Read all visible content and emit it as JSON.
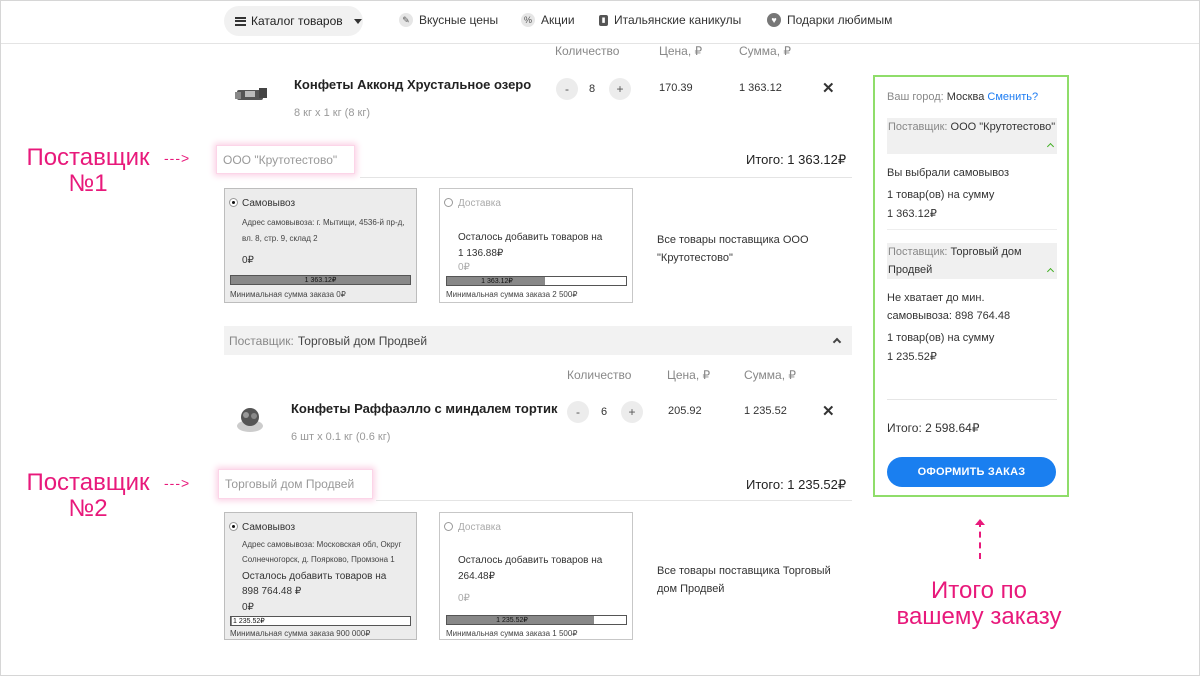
{
  "nav": {
    "catalog": "Каталог товаров",
    "links": [
      {
        "label": "Вкусные цены",
        "icon": "tag-icon"
      },
      {
        "label": "Акции",
        "icon": "percent-icon"
      },
      {
        "label": "Итальянские каникулы",
        "icon": "flag-icon"
      },
      {
        "label": "Подарки любимым",
        "icon": "heart-icon"
      }
    ]
  },
  "supplier1": {
    "headers": {
      "qty": "Количество",
      "price": "Цена, ₽",
      "sum": "Сумма, ₽"
    },
    "product": {
      "name": "Конфеты Акконд Хрустальное озеро",
      "sub": "8 кг x 1 кг (8 кг)",
      "qty": "8",
      "price": "170.39",
      "sum": "1 363.12"
    },
    "name_box": "ООО \"Крутотестово\"",
    "total": "Итого: 1 363.12₽",
    "pickup": {
      "title": "Самовывоз",
      "address": "Адрес самовывоза: г. Мытищи, 4536-й пр-д, вл. 8, стр. 9, склад 2",
      "amount": "0₽",
      "bar_label": "1 363.12₽",
      "bar_fill": 1.0,
      "min": "Минимальная сумма заказа 0₽"
    },
    "delivery": {
      "title": "Доставка",
      "remaining": "Осталось добавить товаров на 1 136.88₽",
      "amount": "0₽",
      "bar_label": "1 363.12₽",
      "bar_fill": 0.55,
      "min": "Минимальная сумма заказа 2 500₽"
    },
    "all_text": "Все товары поставщика ООО \"Крутотестово\""
  },
  "supplier2": {
    "band_label": "Поставщик:",
    "band_name": "Торговый дом Продвей",
    "headers": {
      "qty": "Количество",
      "price": "Цена, ₽",
      "sum": "Сумма, ₽"
    },
    "product": {
      "name": "Конфеты Раффаэлло с миндалем тортик",
      "sub": "6 шт x 0.1 кг (0.6 кг)",
      "qty": "6",
      "price": "205.92",
      "sum": "1 235.52"
    },
    "name_box": "Торговый дом Продвей",
    "total": "Итого: 1 235.52₽",
    "pickup": {
      "title": "Самовывоз",
      "address": "Адрес самовывоза: Московская обл, Округ Солнечногорск, д. Поярково, Промзона 1",
      "remaining": "Осталось добавить товаров на 898 764.48 ₽",
      "amount": "0₽",
      "bar_label": "1 235.52₽",
      "bar_fill": 0.0014,
      "min": "Минимальная сумма заказа 900 000₽"
    },
    "delivery": {
      "title": "Доставка",
      "remaining": "Осталось добавить товаров на 264.48₽",
      "amount": "0₽",
      "bar_label": "1 235.52₽",
      "bar_fill": 0.82,
      "min": "Минимальная сумма заказа 1 500₽"
    },
    "all_text": "Все товары поставщика Торговый дом Продвей"
  },
  "panel": {
    "city_label": "Ваш город:",
    "city": "Москва",
    "change": "Сменить?",
    "s1_label": "Поставщик:",
    "s1_name": "ООО \"Крутотестово\"",
    "s1_status": "Вы выбрали самовывоз",
    "s1_summary": "1 товар(ов) на сумму",
    "s1_amount": "1 363.12₽",
    "s2_label": "Поставщик:",
    "s2_name": "Торговый дом Продвей",
    "s2_status": "Не хватает до мин. самовывоза: 898 764.48",
    "s2_summary": "1 товар(ов) на сумму",
    "s2_amount": "1 235.52₽",
    "total": "Итого: 2 598.64₽",
    "order_button": "ОФОРМИТЬ ЗАКАЗ"
  },
  "annotations": {
    "sup1": "Поставщик\n№1",
    "sup2": "Поставщик\n№2",
    "total": "Итого по\nвашему заказу",
    "arrow": "--->"
  },
  "colors": {
    "accent_pink": "#e8197b",
    "panel_border": "#8fdd6a",
    "button_blue": "#1a7ff0",
    "ok_green": "#3aa12a",
    "warn_red": "#ff2b2b"
  }
}
